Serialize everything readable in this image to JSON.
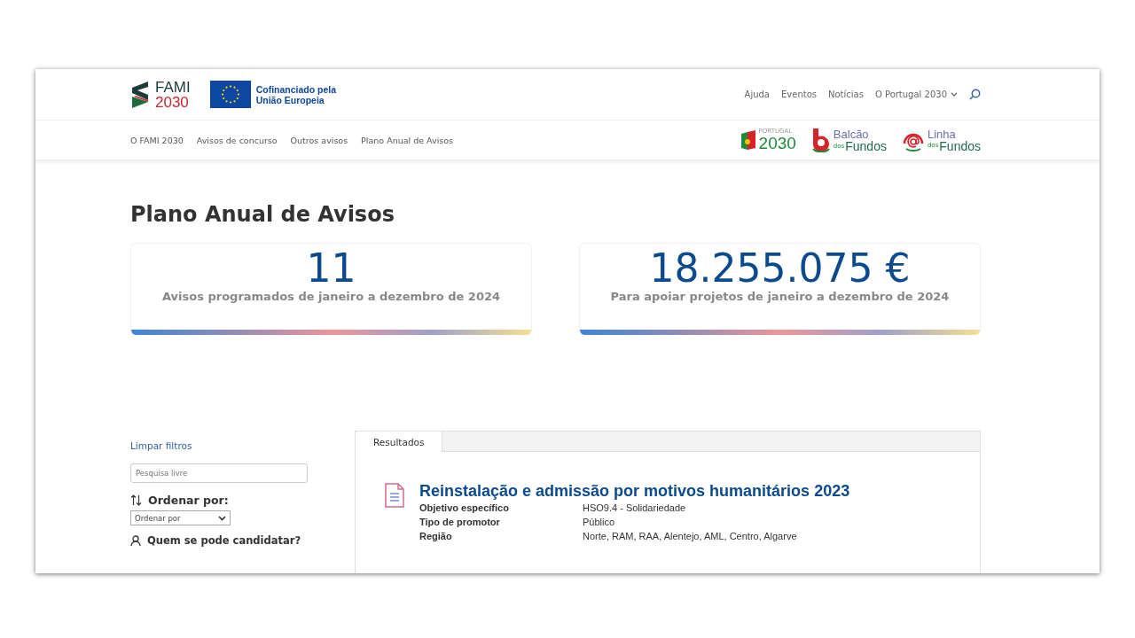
{
  "brand": {
    "name": "FAMI",
    "year": "2030",
    "eu_text": "Cofinanciado pela União Europeia"
  },
  "top_nav": [
    {
      "label": "Ajuda",
      "has_menu": false
    },
    {
      "label": "Eventos",
      "has_menu": false
    },
    {
      "label": "Notícias",
      "has_menu": false
    },
    {
      "label": "O Portugal 2030",
      "has_menu": true
    }
  ],
  "main_nav": [
    "O FAMI 2030",
    "Avisos de concurso",
    "Outros avisos",
    "Plano Anual de Avisos"
  ],
  "partner_logos": [
    {
      "kind": "portugal",
      "small": "PORTUGAL",
      "big": "2030"
    },
    {
      "kind": "balcao",
      "top": "Balcão",
      "small": "dos",
      "big": "Fundos"
    },
    {
      "kind": "linha",
      "top": "Linha",
      "small": "dos",
      "big": "Fundos"
    }
  ],
  "page_title": "Plano Anual de Avisos",
  "stats": [
    {
      "value": "11",
      "caption": "Avisos programados de janeiro a dezembro de 2024"
    },
    {
      "value": "18.255.075 €",
      "caption": "Para apoiar projetos de janeiro a dezembro de 2024"
    }
  ],
  "filters": {
    "clear": "Limpar filtros",
    "search": {
      "placeholder": "Pesquisa livre"
    },
    "sort_heading": "Ordenar por:",
    "sort_select": "Ordenar por",
    "who_heading": "Quem se pode candidatar?"
  },
  "tabs": [
    {
      "label": "Resultados",
      "selected": true
    }
  ],
  "results": [
    {
      "title": "Reinstalação e admissão por motivos humanitários 2023",
      "fields": [
        {
          "label": "Objetivo específico",
          "value": "HSO9.4 - Solidariedade"
        },
        {
          "label": "Tipo de promotor",
          "value": "Público"
        },
        {
          "label": "Região",
          "value": "Norte, RAM, RAA, Alentejo, AML, Centro, Algarve"
        }
      ]
    }
  ]
}
